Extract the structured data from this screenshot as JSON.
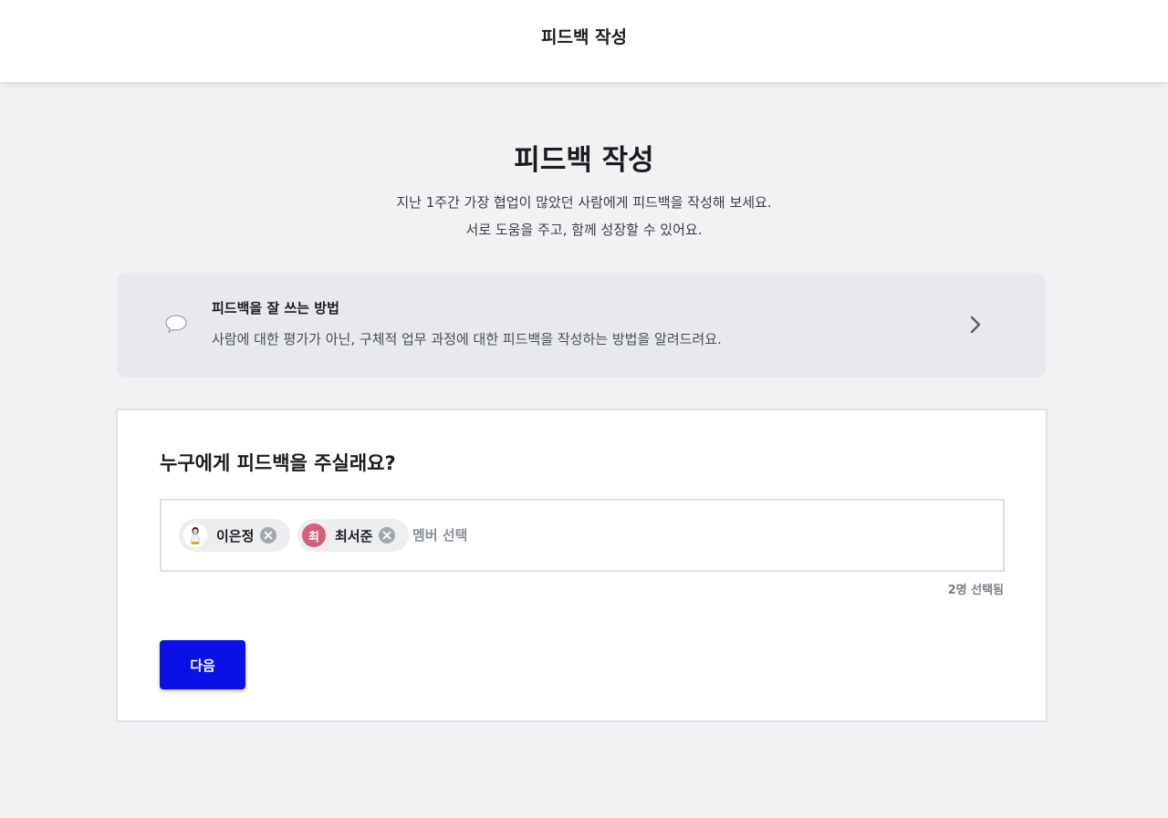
{
  "header": {
    "title": "피드백 작성"
  },
  "hero": {
    "title": "피드백 작성",
    "desc_line1": "지난 1주간 가장 협업이 많았던 사람에게 피드백을 작성해 보세요.",
    "desc_line2": "서로 도움을 주고, 함께 성장할 수 있어요."
  },
  "tip": {
    "icon": "speech-bubble-icon",
    "title": "피드백을 잘 쓰는 방법",
    "desc": "사람에 대한 평가가 아닌, 구체적 업무 과정에 대한 피드백을 작성하는 방법을 알려드려요."
  },
  "recipient": {
    "question": "누구에게 피드백을 주실래요?",
    "members": [
      {
        "name": "이은정",
        "avatar": "photo"
      },
      {
        "name": "최서준",
        "avatar_initial": "최",
        "avatar_color": "#d35f7b"
      }
    ],
    "placeholder": "멤버 선택",
    "selected_count": "2명 선택됨"
  },
  "actions": {
    "next_label": "다음",
    "next_color": "#0a10e6"
  }
}
